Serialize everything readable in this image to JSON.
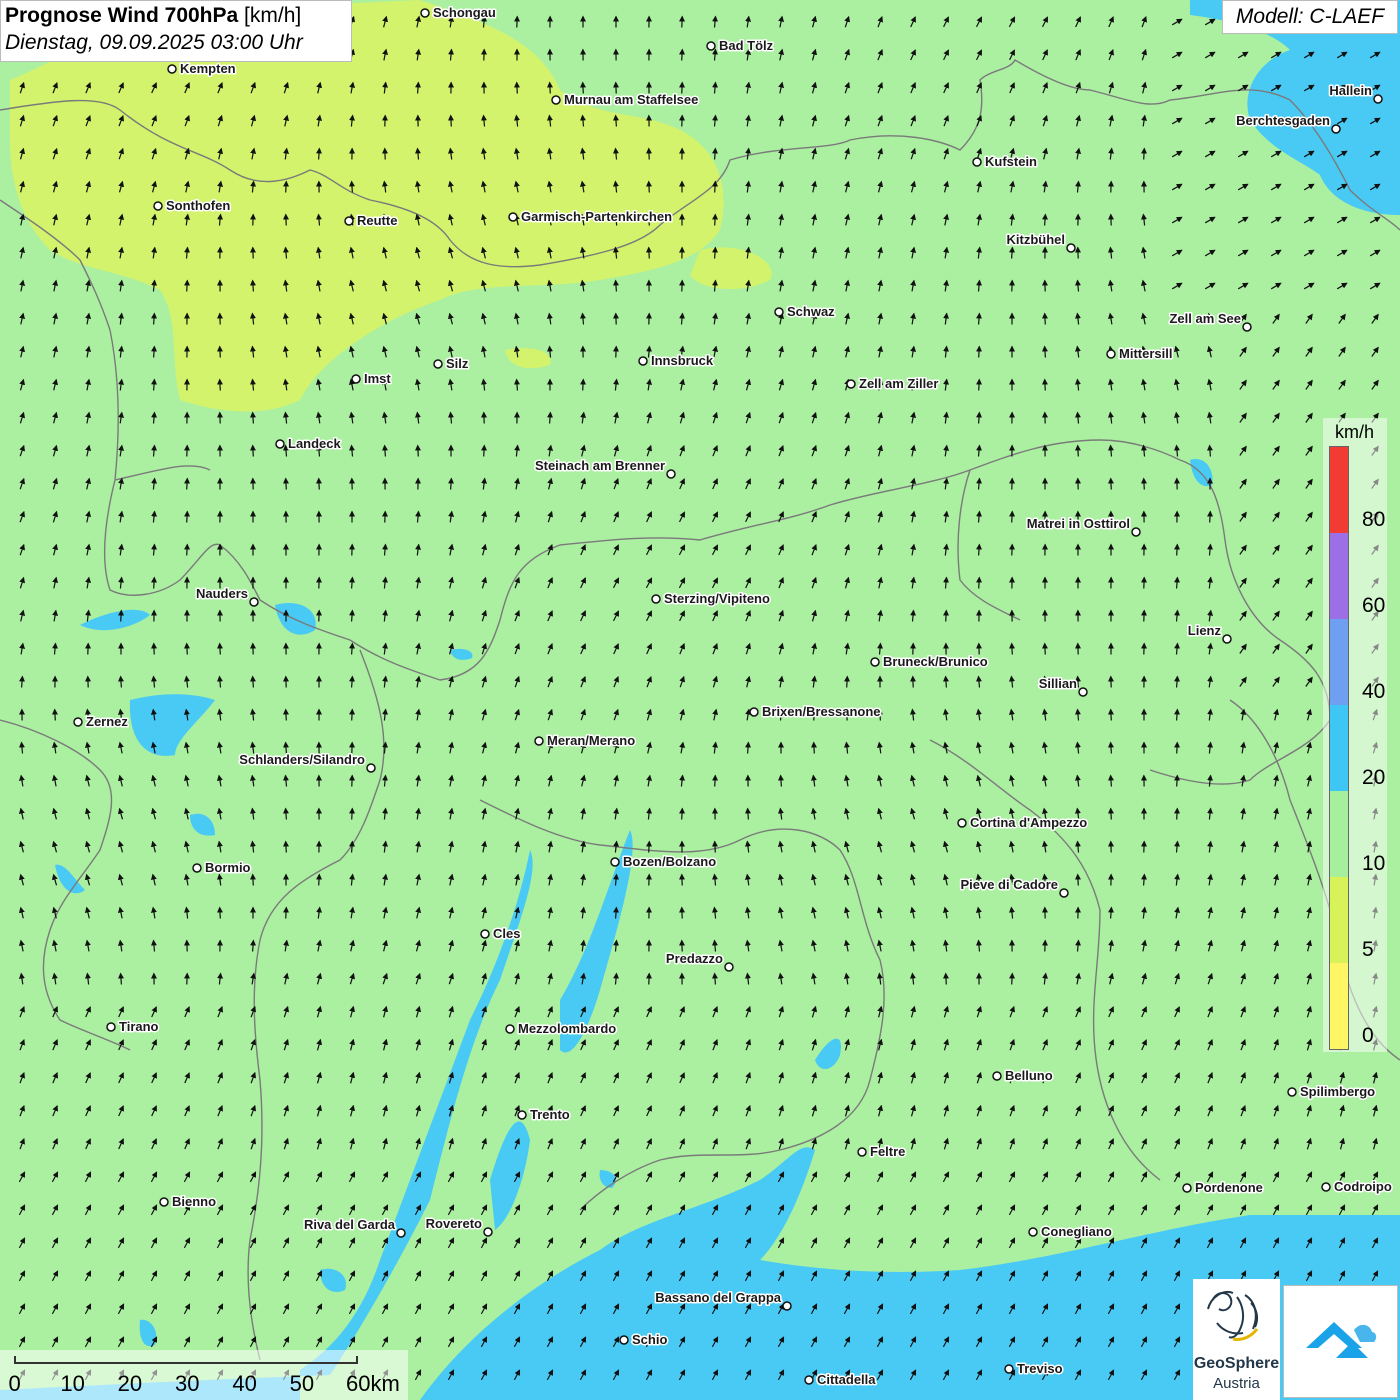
{
  "title": {
    "main": "Prognose Wind 700hPa",
    "unit": "[km/h]",
    "datetime": "Dienstag, 09.09.2025 03:00 Uhr"
  },
  "model": "Modell: C-LAEF",
  "legend": {
    "unit": "km/h",
    "ticks": [
      "0",
      "5",
      "10",
      "20",
      "40",
      "60",
      "80"
    ],
    "colors": [
      "#fff666",
      "#d8f35a",
      "#a6ef9c",
      "#3ec7f5",
      "#6f9ff0",
      "#9c6fe6",
      "#f23b33"
    ]
  },
  "scale": {
    "labels": [
      "0",
      "10",
      "20",
      "30",
      "40",
      "50",
      "60km"
    ]
  },
  "logo": {
    "name": "GeoSphere",
    "sub": "Austria",
    "icons": [
      "geosphere-logo-icon",
      "brand-arrow-icon"
    ]
  },
  "wind_field": {
    "predominant_direction": "north-northeast",
    "max_speed_class": "20-40 km/h (south)",
    "min_speed_class": "5-10 km/h (northwest)"
  },
  "cities": [
    {
      "name": "Schongau",
      "dot": [
        425,
        13
      ],
      "label": "right"
    },
    {
      "name": "Bad Tölz",
      "dot": [
        711,
        46
      ],
      "label": "right"
    },
    {
      "name": "Kempten",
      "dot": [
        172,
        69
      ],
      "label": "right"
    },
    {
      "name": "Murnau am Staffelsee",
      "dot": [
        556,
        100
      ],
      "label": "right"
    },
    {
      "name": "Hallein",
      "dot": [
        1378,
        99
      ],
      "label": "left"
    },
    {
      "name": "Berchtesgaden",
      "dot": [
        1336,
        129
      ],
      "label": "left"
    },
    {
      "name": "Kufstein",
      "dot": [
        977,
        162
      ],
      "label": "right"
    },
    {
      "name": "Sonthofen",
      "dot": [
        158,
        206
      ],
      "label": "right"
    },
    {
      "name": "Reutte",
      "dot": [
        349,
        221
      ],
      "label": "right"
    },
    {
      "name": "Garmisch-Partenkirchen",
      "dot": [
        513,
        217
      ],
      "label": "right"
    },
    {
      "name": "Kitzbühel",
      "dot": [
        1071,
        248
      ],
      "label": "left"
    },
    {
      "name": "Schwaz",
      "dot": [
        779,
        312
      ],
      "label": "right"
    },
    {
      "name": "Zell am See",
      "dot": [
        1247,
        327
      ],
      "label": "left"
    },
    {
      "name": "Mittersill",
      "dot": [
        1111,
        354
      ],
      "label": "right"
    },
    {
      "name": "Innsbruck",
      "dot": [
        643,
        361
      ],
      "label": "right"
    },
    {
      "name": "Silz",
      "dot": [
        438,
        364
      ],
      "label": "right"
    },
    {
      "name": "Imst",
      "dot": [
        356,
        379
      ],
      "label": "right"
    },
    {
      "name": "Zell am Ziller",
      "dot": [
        851,
        384
      ],
      "label": "right"
    },
    {
      "name": "Landeck",
      "dot": [
        280,
        444
      ],
      "label": "right"
    },
    {
      "name": "Steinach am Brenner",
      "dot": [
        671,
        474
      ],
      "label": "left"
    },
    {
      "name": "Matrei in Osttirol",
      "dot": [
        1136,
        532
      ],
      "label": "left"
    },
    {
      "name": "Nauders",
      "dot": [
        254,
        602
      ],
      "label": "left"
    },
    {
      "name": "Sterzing/Vipiteno",
      "dot": [
        656,
        599
      ],
      "label": "right"
    },
    {
      "name": "Lienz",
      "dot": [
        1227,
        639
      ],
      "label": "left"
    },
    {
      "name": "Bruneck/Brunico",
      "dot": [
        875,
        662
      ],
      "label": "right"
    },
    {
      "name": "Sillian",
      "dot": [
        1083,
        692
      ],
      "label": "left"
    },
    {
      "name": "Brixen/Bressanone",
      "dot": [
        754,
        712
      ],
      "label": "right"
    },
    {
      "name": "Zernez",
      "dot": [
        78,
        722
      ],
      "label": "right"
    },
    {
      "name": "Meran/Merano",
      "dot": [
        539,
        741
      ],
      "label": "right"
    },
    {
      "name": "Schlanders/Silandro",
      "dot": [
        371,
        768
      ],
      "label": "left"
    },
    {
      "name": "Cortina d'Ampezzo",
      "dot": [
        962,
        823
      ],
      "label": "right"
    },
    {
      "name": "Bozen/Bolzano",
      "dot": [
        615,
        862
      ],
      "label": "right"
    },
    {
      "name": "Bormio",
      "dot": [
        197,
        868
      ],
      "label": "right"
    },
    {
      "name": "Pieve di Cadore",
      "dot": [
        1064,
        893
      ],
      "label": "left"
    },
    {
      "name": "Cles",
      "dot": [
        485,
        934
      ],
      "label": "right"
    },
    {
      "name": "Predazzo",
      "dot": [
        729,
        967
      ],
      "label": "left"
    },
    {
      "name": "Tirano",
      "dot": [
        111,
        1027
      ],
      "label": "right"
    },
    {
      "name": "Mezzolombardo",
      "dot": [
        510,
        1029
      ],
      "label": "right"
    },
    {
      "name": "Belluno",
      "dot": [
        997,
        1076
      ],
      "label": "right"
    },
    {
      "name": "Spilimbergo",
      "dot": [
        1292,
        1092
      ],
      "label": "right"
    },
    {
      "name": "Trento",
      "dot": [
        522,
        1115
      ],
      "label": "right"
    },
    {
      "name": "Feltre",
      "dot": [
        862,
        1152
      ],
      "label": "right"
    },
    {
      "name": "Pordenone",
      "dot": [
        1187,
        1188
      ],
      "label": "right"
    },
    {
      "name": "Codroipo",
      "dot": [
        1326,
        1187
      ],
      "label": "right"
    },
    {
      "name": "Bienno",
      "dot": [
        164,
        1202
      ],
      "label": "right"
    },
    {
      "name": "Riva del Garda",
      "dot": [
        401,
        1233
      ],
      "label": "left"
    },
    {
      "name": "Rovereto",
      "dot": [
        488,
        1232
      ],
      "label": "left"
    },
    {
      "name": "Conegliano",
      "dot": [
        1033,
        1232
      ],
      "label": "right"
    },
    {
      "name": "Bassano del Grappa",
      "dot": [
        787,
        1306
      ],
      "label": "left"
    },
    {
      "name": "Schio",
      "dot": [
        624,
        1340
      ],
      "label": "right"
    },
    {
      "name": "Treviso",
      "dot": [
        1009,
        1369
      ],
      "label": "right"
    },
    {
      "name": "Cittadella",
      "dot": [
        809,
        1380
      ],
      "label": "right"
    }
  ]
}
